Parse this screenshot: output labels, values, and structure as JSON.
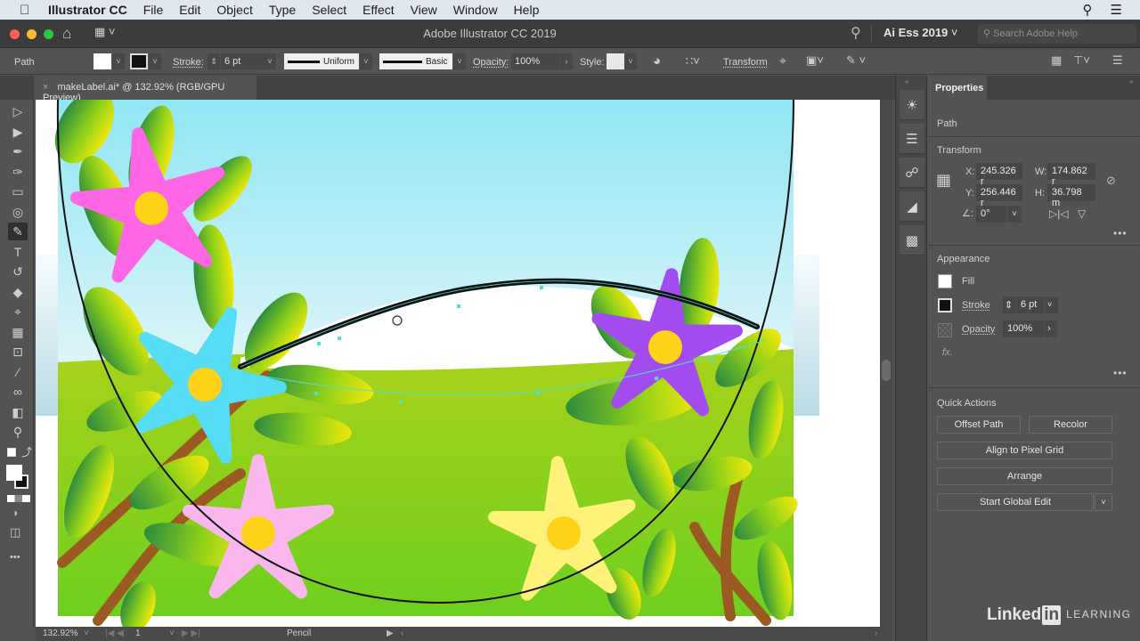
{
  "menubar": {
    "app_name": "Illustrator CC",
    "items": [
      "File",
      "Edit",
      "Object",
      "Type",
      "Select",
      "Effect",
      "View",
      "Window",
      "Help"
    ]
  },
  "titlebar": {
    "title": "Adobe Illustrator CC 2019",
    "workspace": "Ai Ess 2019",
    "search_placeholder": "Search Adobe Help"
  },
  "controlbar": {
    "selection_type": "Path",
    "stroke_label": "Stroke:",
    "stroke_weight": "6 pt",
    "variable_width_profile": "Uniform",
    "brush": "Basic",
    "opacity_label": "Opacity:",
    "opacity_value": "100%",
    "style_label": "Style:",
    "transform_label": "Transform"
  },
  "document_tab": {
    "close": "×",
    "title": "makeLabel.ai* @ 132.92% (RGB/GPU Preview)"
  },
  "statusbar": {
    "zoom": "132.92%",
    "artboard": "1",
    "current_tool": "Pencil"
  },
  "tools": [
    {
      "name": "selection-tool",
      "glyph": "▷"
    },
    {
      "name": "direct-selection-tool",
      "glyph": "▶"
    },
    {
      "name": "pen-tool",
      "glyph": "✒"
    },
    {
      "name": "curvature-tool",
      "glyph": "✑"
    },
    {
      "name": "rectangle-tool",
      "glyph": "▭"
    },
    {
      "name": "spiral-tool",
      "glyph": "◎"
    },
    {
      "name": "pencil-tool",
      "glyph": "✎",
      "active": true
    },
    {
      "name": "type-tool",
      "glyph": "T"
    },
    {
      "name": "rotate-tool",
      "glyph": "↺"
    },
    {
      "name": "eraser-tool",
      "glyph": "◆"
    },
    {
      "name": "puppet-warp-tool",
      "glyph": "⌖"
    },
    {
      "name": "gradient-tool",
      "glyph": "▦"
    },
    {
      "name": "artboard-tool",
      "glyph": "⊡"
    },
    {
      "name": "eyedropper-tool",
      "glyph": "⁄"
    },
    {
      "name": "blend-tool",
      "glyph": "∞"
    },
    {
      "name": "shape-builder-tool",
      "glyph": "◧"
    },
    {
      "name": "zoom-tool",
      "glyph": "⚲"
    }
  ],
  "dock_icons": [
    "properties",
    "layers",
    "libraries",
    "gradient",
    "transparency"
  ],
  "properties": {
    "tab": "Properties",
    "object_type": "Path",
    "transform": {
      "title": "Transform",
      "x_label": "X:",
      "x": "245.326 r",
      "y_label": "Y:",
      "y": "256.446 r",
      "w_label": "W:",
      "w": "174.862 r",
      "h_label": "H:",
      "h": "36.798 m",
      "angle": "0°"
    },
    "appearance": {
      "title": "Appearance",
      "fill_label": "Fill",
      "stroke_label": "Stroke",
      "stroke_weight": "6 pt",
      "opacity_label": "Opacity",
      "opacity": "100%",
      "fx": "fx."
    },
    "quick_actions": {
      "title": "Quick Actions",
      "buttons": [
        "Offset Path",
        "Recolor",
        "Align to Pixel Grid",
        "Arrange",
        "Start Global Edit"
      ]
    },
    "more": "•••"
  },
  "branding": {
    "linked": "Linked",
    "in": "in",
    "learning": "LEARNING"
  },
  "artwork": {
    "description": "Landscape illustration with sky, grass, leafy plants and five-petal flowers; selected pencil path across the middle",
    "colors": {
      "sky_top": "#8fe6f4",
      "sky_bottom": "#ffffff",
      "grass": "#8fd11a",
      "leaf_dark": "#2e8b3e",
      "leaf_light": "#e6e60a",
      "stem": "#9b5a22",
      "flower_magenta": "#ff66e6",
      "flower_cyan": "#57dcf5",
      "flower_purple": "#a24cf0",
      "flower_pink": "#f9b7ee",
      "flower_yellow": "#fff27a",
      "flower_center": "#ffd21a",
      "selection": "#4fe0d0"
    }
  }
}
